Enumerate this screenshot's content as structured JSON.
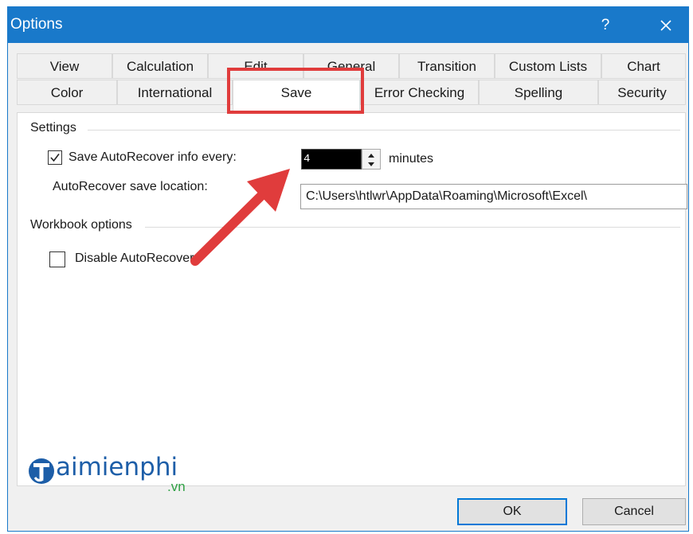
{
  "window": {
    "title": "Options",
    "help": "?",
    "close_icon": "close-icon"
  },
  "tabs_row1": [
    "View",
    "Calculation",
    "Edit",
    "General",
    "Transition",
    "Custom Lists",
    "Chart"
  ],
  "tabs_row2": [
    "Color",
    "International",
    "Save",
    "Error Checking",
    "Spelling",
    "Security"
  ],
  "active_tab": "Save",
  "settings": {
    "group_label": "Settings",
    "autorecover_label": "Save AutoRecover info every:",
    "autorecover_checked": true,
    "interval_value": "4",
    "minutes_label": "minutes",
    "location_label": "AutoRecover save location:",
    "location_value": "C:\\Users\\htlwr\\AppData\\Roaming\\Microsoft\\Excel\\"
  },
  "workbook": {
    "group_label": "Workbook options",
    "disable_label": "Disable AutoRecover",
    "disable_checked": false
  },
  "buttons": {
    "ok": "OK",
    "cancel": "Cancel"
  },
  "watermark": {
    "brand": "aimienphi",
    "tld": ".vn"
  },
  "colors": {
    "titlebar": "#1979ca",
    "highlight": "#e03c3c",
    "arrow": "#e03c3c"
  }
}
